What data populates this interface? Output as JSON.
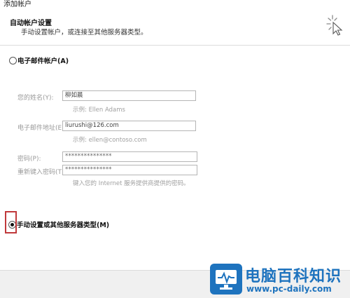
{
  "window": {
    "title": "添加帐户"
  },
  "header": {
    "title": "自动帐户设置",
    "subtitle": "手动设置帐户，或连接至其他服务器类型。",
    "icon": "sparkle-cursor-icon"
  },
  "options": {
    "email_account": {
      "label": "电子邮件帐户(A)",
      "selected": false
    },
    "manual_setup": {
      "label": "手动设置或其他服务器类型(M)",
      "selected": true
    }
  },
  "form": {
    "name": {
      "label": "您的姓名(Y):",
      "value": "柳如晨",
      "hint": "示例: Ellen Adams"
    },
    "email": {
      "label": "电子邮件地址(E):",
      "value": "liurushi@126.com",
      "hint": "示例: ellen@contoso.com"
    },
    "password": {
      "label": "密码(P):",
      "value": "***************"
    },
    "password_confirm": {
      "label": "重新键入密码(T):",
      "value": "***************"
    },
    "password_hint": "键入您的 Internet 服务提供商提供的密码。"
  },
  "watermark": {
    "title": "电脑百科知识",
    "url": "www.pc-daily.com",
    "color": "#1e73be"
  },
  "highlight_color": "#c0393b"
}
